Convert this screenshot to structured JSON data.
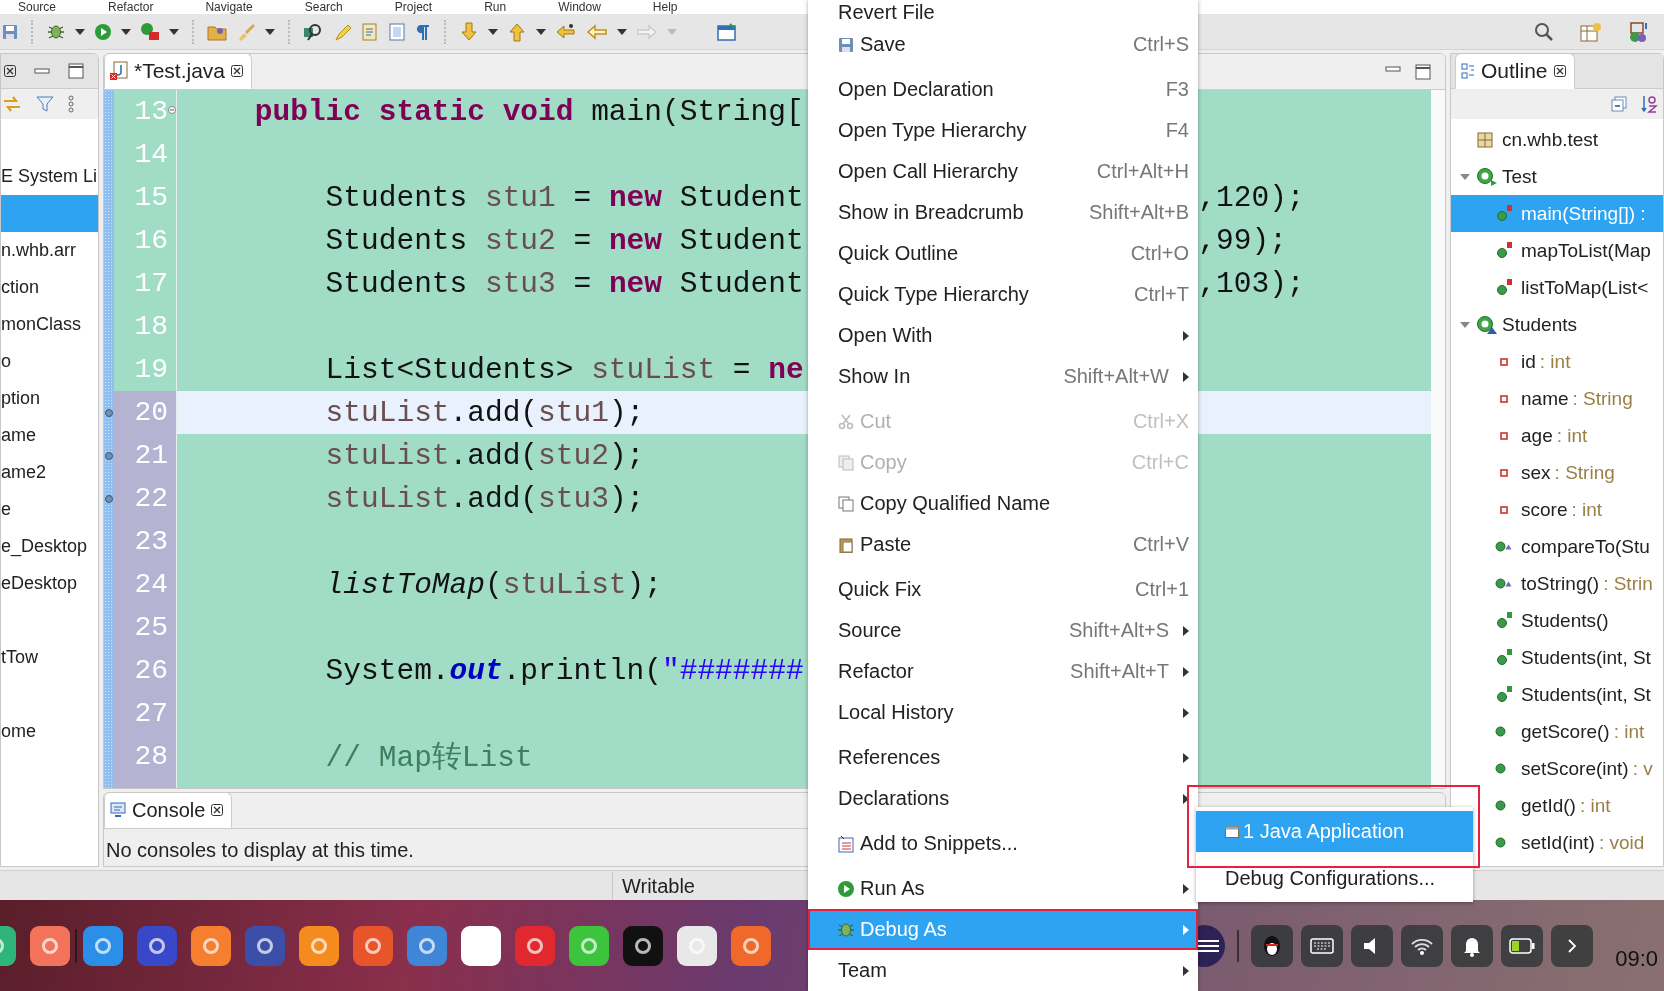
{
  "menu_bar": [
    "Source",
    "Refactor",
    "Navigate",
    "Search",
    "Project",
    "Run",
    "Window",
    "Help"
  ],
  "package_explorer": {
    "items": [
      {
        "label": "E System Li",
        "selected": false
      },
      {
        "selected": true
      },
      {
        "label": "n.whb.arr",
        "selected": false
      },
      {
        "label": "ction",
        "selected": false
      },
      {
        "label": "monClass",
        "selected": false
      },
      {
        "label": "o",
        "selected": false
      },
      {
        "label": "ption",
        "selected": false
      },
      {
        "label": "ame",
        "selected": false
      },
      {
        "label": "ame2",
        "selected": false
      },
      {
        "label": "e",
        "selected": false
      },
      {
        "label": "e_Desktop",
        "selected": false
      },
      {
        "label": "eDesktop",
        "selected": false
      },
      {
        "selected": false
      },
      {
        "label": "tTow",
        "selected": false
      },
      {
        "selected": false
      },
      {
        "label": "ome",
        "selected": false
      }
    ]
  },
  "editor": {
    "tab": {
      "label": "*Test.java",
      "selected": true
    },
    "lines": [
      {
        "number": "13",
        "changed": false,
        "marker": false,
        "current": false,
        "tokens": [
          {
            "text": "    public static void",
            "kind": "keyword"
          },
          {
            "text": " main(String[",
            "kind": "plain"
          }
        ]
      },
      {
        "number": "14",
        "changed": false,
        "marker": false,
        "current": false
      },
      {
        "number": "15",
        "changed": false,
        "marker": false,
        "current": false,
        "tokens": [
          {
            "text": "        Students ",
            "kind": "plain"
          },
          {
            "text": "stu1",
            "kind": "variable"
          },
          {
            "text": " = ",
            "kind": "plain"
          },
          {
            "text": "new",
            "kind": "keyword"
          },
          {
            "text": " Student",
            "kind": "plain"
          }
        ],
        "right_text": ",120);"
      },
      {
        "number": "16",
        "changed": false,
        "marker": false,
        "current": false,
        "tokens": [
          {
            "text": "        Students ",
            "kind": "plain"
          },
          {
            "text": "stu2",
            "kind": "variable"
          },
          {
            "text": " = ",
            "kind": "plain"
          },
          {
            "text": "new",
            "kind": "keyword"
          },
          {
            "text": " Student",
            "kind": "plain"
          }
        ],
        "right_text": ",99);"
      },
      {
        "number": "17",
        "changed": false,
        "marker": false,
        "current": false,
        "tokens": [
          {
            "text": "        Students ",
            "kind": "plain"
          },
          {
            "text": "stu3",
            "kind": "variable"
          },
          {
            "text": " = ",
            "kind": "plain"
          },
          {
            "text": "new",
            "kind": "keyword"
          },
          {
            "text": " Student",
            "kind": "plain"
          }
        ],
        "right_text": ",103);"
      },
      {
        "number": "18",
        "changed": false,
        "marker": false,
        "current": false
      },
      {
        "number": "19",
        "changed": false,
        "marker": false,
        "current": false,
        "tokens": [
          {
            "text": "        List<Students> ",
            "kind": "plain"
          },
          {
            "text": "stuList",
            "kind": "variable"
          },
          {
            "text": " = ",
            "kind": "plain"
          },
          {
            "text": "ne",
            "kind": "keyword"
          }
        ]
      },
      {
        "number": "20",
        "changed": true,
        "marker": true,
        "current": true,
        "tokens": [
          {
            "text": "        stuList",
            "kind": "variable"
          },
          {
            "text": ".add(",
            "kind": "plain"
          },
          {
            "text": "stu1",
            "kind": "variable"
          },
          {
            "text": ");",
            "kind": "plain"
          }
        ]
      },
      {
        "number": "21",
        "changed": true,
        "marker": true,
        "current": false,
        "tokens": [
          {
            "text": "        stuList",
            "kind": "variable"
          },
          {
            "text": ".add(",
            "kind": "plain"
          },
          {
            "text": "stu2",
            "kind": "variable"
          },
          {
            "text": ");",
            "kind": "plain"
          }
        ]
      },
      {
        "number": "22",
        "changed": true,
        "marker": true,
        "current": false,
        "tokens": [
          {
            "text": "        stuList",
            "kind": "variable"
          },
          {
            "text": ".add(",
            "kind": "plain"
          },
          {
            "text": "stu3",
            "kind": "variable"
          },
          {
            "text": ");",
            "kind": "plain"
          }
        ]
      },
      {
        "number": "23",
        "changed": true,
        "marker": false,
        "current": false
      },
      {
        "number": "24",
        "changed": true,
        "marker": false,
        "current": false,
        "tokens": [
          {
            "text": "        listToMap",
            "kind": "static_method"
          },
          {
            "text": "(",
            "kind": "plain"
          },
          {
            "text": "stuList",
            "kind": "variable"
          },
          {
            "text": ");",
            "kind": "plain"
          }
        ]
      },
      {
        "number": "25",
        "changed": true,
        "marker": false,
        "current": false
      },
      {
        "number": "26",
        "changed": true,
        "marker": false,
        "current": false,
        "tokens": [
          {
            "text": "        System.",
            "kind": "plain"
          },
          {
            "text": "out",
            "kind": "static_field"
          },
          {
            "text": ".println(",
            "kind": "plain"
          },
          {
            "text": "\"#######",
            "kind": "string"
          }
        ]
      },
      {
        "number": "27",
        "changed": true,
        "marker": false,
        "current": false
      },
      {
        "number": "28",
        "changed": true,
        "marker": false,
        "current": false,
        "tokens": [
          {
            "text": "        // Map转List",
            "kind": "comment"
          }
        ]
      }
    ]
  },
  "console": {
    "tab": {
      "label": "Console",
      "selected": true
    },
    "message": "No consoles to display at this time."
  },
  "outline": {
    "tab": {
      "label": "Outline",
      "selected": true
    },
    "tree": [
      {
        "label": "cn.whb.test",
        "kind": "package",
        "selected": false
      },
      {
        "label": "Test",
        "kind": "main_class",
        "selected": false,
        "expanded": true,
        "children": [
          {
            "label": "main(String[]) :",
            "kind": "static_method",
            "selected": true
          },
          {
            "label": "mapToList(Map",
            "kind": "static_method",
            "selected": false
          },
          {
            "label": "listToMap(List<",
            "kind": "static_method",
            "selected": false
          }
        ]
      },
      {
        "label": "Students",
        "kind": "class",
        "selected": false,
        "expanded": true,
        "children": [
          {
            "label": "id",
            "type": ": int",
            "kind": "field",
            "selected": false
          },
          {
            "label": "name",
            "type": ": String",
            "kind": "field",
            "selected": false
          },
          {
            "label": "age",
            "type": ": int",
            "kind": "field",
            "selected": false
          },
          {
            "label": "sex",
            "type": ": String",
            "kind": "field",
            "selected": false
          },
          {
            "label": "score",
            "type": ": int",
            "kind": "field",
            "selected": false
          },
          {
            "label": "compareTo(Stu",
            "kind": "override_method",
            "selected": false
          },
          {
            "label": "toString()",
            "type": ": Strin",
            "kind": "override_method",
            "selected": false
          },
          {
            "label": "Students()",
            "kind": "constructor",
            "selected": false
          },
          {
            "label": "Students(int, St",
            "kind": "constructor",
            "selected": false
          },
          {
            "label": "Students(int, St",
            "kind": "constructor",
            "selected": false
          },
          {
            "label": "getScore()",
            "type": ": int",
            "kind": "method",
            "selected": false
          },
          {
            "label": "setScore(int)",
            "type": ": v",
            "kind": "method",
            "selected": false
          },
          {
            "label": "getId()",
            "type": ": int",
            "kind": "method",
            "selected": false
          },
          {
            "label": "setId(int)",
            "type": ": void",
            "kind": "method",
            "selected": false
          }
        ]
      }
    ]
  },
  "status_bar": {
    "mode": "Writable"
  },
  "context_menu": {
    "items": [
      {
        "kind": "item",
        "label": "Revert File",
        "disabled": false,
        "selected": false,
        "submenu": false
      },
      {
        "kind": "item",
        "label": "Save",
        "shortcut": "Ctrl+S",
        "disabled": false,
        "selected": false,
        "submenu": false
      },
      {
        "kind": "separator"
      },
      {
        "kind": "item",
        "label": "Open Declaration",
        "shortcut": "F3",
        "disabled": false,
        "selected": false,
        "submenu": false
      },
      {
        "kind": "item",
        "label": "Open Type Hierarchy",
        "shortcut": "F4",
        "disabled": false,
        "selected": false,
        "submenu": false
      },
      {
        "kind": "item",
        "label": "Open Call Hierarchy",
        "shortcut": "Ctrl+Alt+H",
        "disabled": false,
        "selected": false,
        "submenu": false
      },
      {
        "kind": "item",
        "label": "Show in Breadcrumb",
        "shortcut": "Shift+Alt+B",
        "disabled": false,
        "selected": false,
        "submenu": false
      },
      {
        "kind": "item",
        "label": "Quick Outline",
        "shortcut": "Ctrl+O",
        "disabled": false,
        "selected": false,
        "submenu": false
      },
      {
        "kind": "item",
        "label": "Quick Type Hierarchy",
        "shortcut": "Ctrl+T",
        "disabled": false,
        "selected": false,
        "submenu": false
      },
      {
        "kind": "item",
        "label": "Open With",
        "disabled": false,
        "selected": false,
        "submenu": true
      },
      {
        "kind": "item",
        "label": "Show In",
        "shortcut": "Shift+Alt+W",
        "disabled": false,
        "selected": false,
        "submenu": true
      },
      {
        "kind": "separator"
      },
      {
        "kind": "item",
        "label": "Cut",
        "shortcut": "Ctrl+X",
        "disabled": true,
        "selected": false,
        "submenu": false
      },
      {
        "kind": "item",
        "label": "Copy",
        "shortcut": "Ctrl+C",
        "disabled": true,
        "selected": false,
        "submenu": false
      },
      {
        "kind": "item",
        "label": "Copy Qualified Name",
        "disabled": false,
        "selected": false,
        "submenu": false
      },
      {
        "kind": "item",
        "label": "Paste",
        "shortcut": "Ctrl+V",
        "disabled": false,
        "selected": false,
        "submenu": false
      },
      {
        "kind": "separator"
      },
      {
        "kind": "item",
        "label": "Quick Fix",
        "shortcut": "Ctrl+1",
        "disabled": false,
        "selected": false,
        "submenu": false
      },
      {
        "kind": "item",
        "label": "Source",
        "shortcut": "Shift+Alt+S",
        "disabled": false,
        "selected": false,
        "submenu": true
      },
      {
        "kind": "item",
        "label": "Refactor",
        "shortcut": "Shift+Alt+T",
        "disabled": false,
        "selected": false,
        "submenu": true
      },
      {
        "kind": "item",
        "label": "Local History",
        "disabled": false,
        "selected": false,
        "submenu": true
      },
      {
        "kind": "separator"
      },
      {
        "kind": "item",
        "label": "References",
        "disabled": false,
        "selected": false,
        "submenu": true
      },
      {
        "kind": "item",
        "label": "Declarations",
        "disabled": false,
        "selected": false,
        "submenu": true
      },
      {
        "kind": "separator"
      },
      {
        "kind": "item",
        "label": "Add to Snippets...",
        "disabled": false,
        "selected": false,
        "submenu": false
      },
      {
        "kind": "separator"
      },
      {
        "kind": "item",
        "label": "Run As",
        "disabled": false,
        "selected": false,
        "submenu": true
      },
      {
        "kind": "item",
        "label": "Debug As",
        "disabled": false,
        "selected": true,
        "submenu": true
      },
      {
        "kind": "item",
        "label": "Team",
        "disabled": false,
        "selected": false,
        "submenu": true
      }
    ]
  },
  "submenu": {
    "items": [
      {
        "label": "1 Java Application",
        "selected": true
      },
      {
        "label": "Debug Configurations...",
        "selected": false
      }
    ]
  },
  "dock": [
    {
      "color": "#2fb57a"
    },
    {
      "color": "#f2735a"
    },
    {
      "color": "#2b8fe8"
    },
    {
      "color": "#3848c8"
    },
    {
      "color": "#f57f2e"
    },
    {
      "color": "#3b4fa8"
    },
    {
      "color": "#f58a1e"
    },
    {
      "color": "#e8552a"
    },
    {
      "color": "#3f86d6"
    },
    {
      "color": "#ffffff"
    },
    {
      "color": "#e0282e"
    },
    {
      "color": "#3cc43c"
    },
    {
      "color": "#111111"
    },
    {
      "color": "#e8e8e8"
    },
    {
      "color": "#f0682a"
    }
  ],
  "clock": "09:0"
}
